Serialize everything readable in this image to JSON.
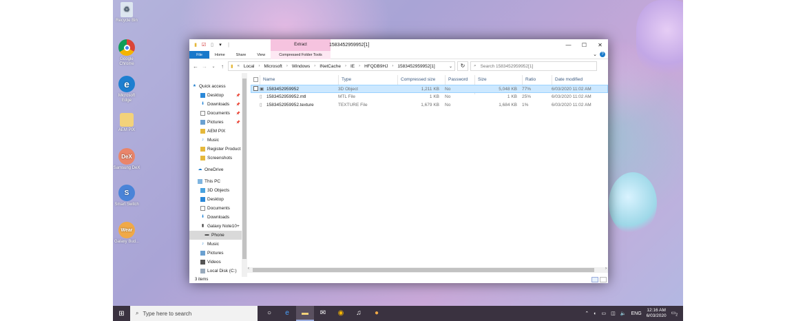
{
  "desktop": {
    "icons": [
      {
        "label": "Recycle Bin",
        "icon": "recycle-bin-icon"
      },
      {
        "label": "Google Chrome",
        "icon": "chrome-icon"
      },
      {
        "label": "Microsoft Edge",
        "icon": "edge-icon"
      },
      {
        "label": "AEM PIX",
        "icon": "folder-icon"
      },
      {
        "label": "Samsung DeX",
        "icon": "dex-icon",
        "glyph": "DeX"
      },
      {
        "label": "Smart Switch",
        "icon": "smart-switch-icon",
        "glyph": "S"
      },
      {
        "label": "Galaxy Bud...",
        "icon": "galaxy-wear-icon",
        "glyph": "Wear"
      }
    ]
  },
  "window": {
    "title": "1583452959952[1]",
    "context_tab": "Extract",
    "ribbon": {
      "tabs": [
        "File",
        "Home",
        "Share",
        "View"
      ],
      "tools_tab": "Compressed Folder Tools"
    },
    "address": {
      "crumbs": [
        "Local",
        "Microsoft",
        "Windows",
        "INetCache",
        "IE",
        "HFQDB9HJ",
        "1583452959952[1]"
      ]
    },
    "search": {
      "placeholder": "Search 1583452959952[1]"
    },
    "nav": {
      "quick_access": "Quick access",
      "quick_items": [
        "Desktop",
        "Downloads",
        "Documents",
        "Pictures",
        "AEM PIX",
        "Music",
        "Register Product",
        "Screenshots"
      ],
      "onedrive": "OneDrive",
      "this_pc": "This PC",
      "pc_items": [
        "3D Objects",
        "Desktop",
        "Documents",
        "Downloads",
        "Galaxy Note10+",
        "Phone",
        "Music",
        "Pictures",
        "Videos",
        "Local Disk (C:)"
      ]
    },
    "columns": [
      "Name",
      "Type",
      "Compressed size",
      "Password p...",
      "Size",
      "Ratio",
      "Date modified"
    ],
    "files": [
      {
        "name": "1583452959952",
        "type": "3D Object",
        "compressed": "1,211 KB",
        "password": "No",
        "size": "5,048 KB",
        "ratio": "77%",
        "date": "6/03/2020 11:02 AM"
      },
      {
        "name": "1583452959952.mtl",
        "type": "MTL File",
        "compressed": "1 KB",
        "password": "No",
        "size": "1 KB",
        "ratio": "25%",
        "date": "6/03/2020 11:02 AM"
      },
      {
        "name": "1583452959952.texture",
        "type": "TEXTURE File",
        "compressed": "1,679 KB",
        "password": "No",
        "size": "1,684 KB",
        "ratio": "1%",
        "date": "6/03/2020 11:02 AM"
      }
    ],
    "status": "3 items"
  },
  "taskbar": {
    "search_placeholder": "Type here to search",
    "lang": "ENG",
    "time": "12:16 AM",
    "date": "6/03/2020",
    "notif_count": "2"
  }
}
